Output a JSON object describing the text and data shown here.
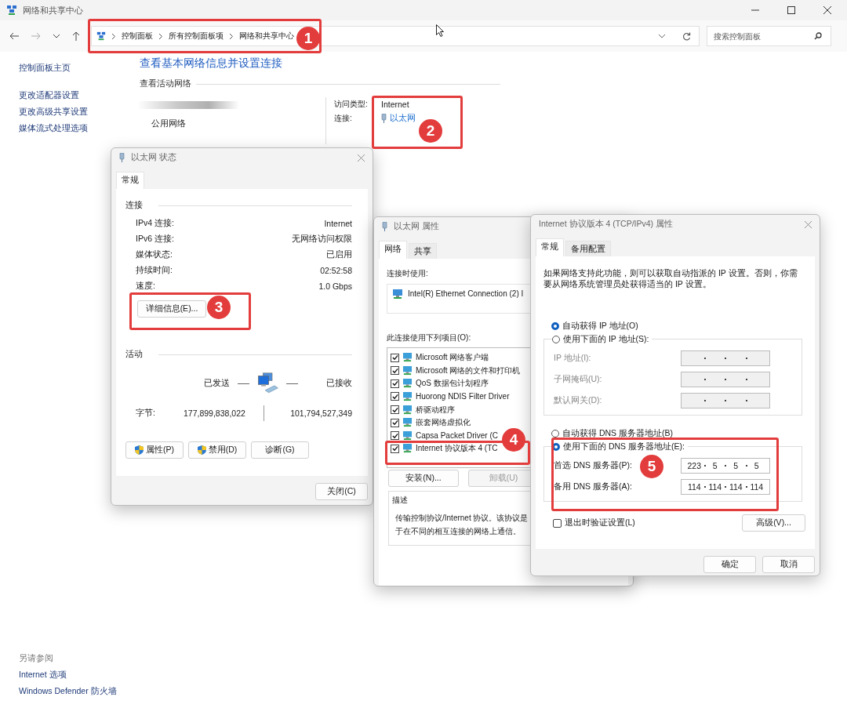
{
  "window": {
    "title": "网络和共享中心"
  },
  "address_bar": {
    "crumbs": [
      "控制面板",
      "所有控制面板项",
      "网络和共享中心"
    ]
  },
  "search": {
    "placeholder": "搜索控制面板"
  },
  "sidebar": {
    "links": [
      "控制面板主页",
      "更改适配器设置",
      "更改高级共享设置",
      "媒体流式处理选项"
    ],
    "see_also_title": "另请参阅",
    "see_also": [
      "Internet 选项",
      "Windows Defender 防火墙"
    ]
  },
  "main": {
    "heading": "查看基本网络信息并设置连接",
    "section": "查看活动网络",
    "network_type": "公用网络",
    "access_label": "访问类型:",
    "access_value": "Internet",
    "connection_label": "连接:",
    "connection_link": "以太网"
  },
  "status_dialog": {
    "title": "以太网 状态",
    "tabs": [
      {
        "label": "常规",
        "selected": true
      }
    ],
    "connection_group": "连接",
    "rows": [
      {
        "label": "IPv4 连接:",
        "value": "Internet"
      },
      {
        "label": "IPv6 连接:",
        "value": "无网络访问权限"
      },
      {
        "label": "媒体状态:",
        "value": "已启用"
      },
      {
        "label": "持续时间:",
        "value": "02:52:58"
      },
      {
        "label": "速度:",
        "value": "1.0 Gbps"
      }
    ],
    "details_button": "详细信息(E)...",
    "activity_group": "活动",
    "sent": "已发送",
    "received": "已接收",
    "bytes_label": "字节:",
    "bytes_sent": "177,899,838,022",
    "bytes_received": "101,794,527,349",
    "buttons": [
      {
        "label": "属性(P)",
        "shield": true
      },
      {
        "label": "禁用(D)",
        "shield": true
      },
      {
        "label": "诊断(G)",
        "shield": false
      }
    ],
    "close_button": "关闭(C)"
  },
  "properties_dialog": {
    "title": "以太网 属性",
    "tabs": [
      {
        "label": "网络",
        "selected": true
      },
      {
        "label": "共享",
        "selected": false
      }
    ],
    "connect_using_label": "连接时使用:",
    "adapter": "Intel(R) Ethernet Connection (2) I",
    "items_label": "此连接使用下列项目(O):",
    "items": [
      {
        "label": "Microsoft 网络客户端",
        "checked": true
      },
      {
        "label": "Microsoft 网络的文件和打印机",
        "checked": true
      },
      {
        "label": "QoS 数据包计划程序",
        "checked": true
      },
      {
        "label": "Huorong NDIS Filter Driver",
        "checked": true
      },
      {
        "label": "桥驱动程序",
        "checked": true
      },
      {
        "label": "嵌套网络虚拟化",
        "checked": true
      },
      {
        "label": "Capsa Packet Driver (C",
        "checked": true
      },
      {
        "label": "Internet 协议版本 4 (TC",
        "checked": true
      }
    ],
    "buttons": [
      {
        "label": "安装(N)...",
        "disabled": false
      },
      {
        "label": "卸载(U)",
        "disabled": true
      }
    ],
    "description_group": "描述",
    "description": [
      "传输控制协议/Internet 协议。该协议是",
      "于在不同的相互连接的网络上通信。"
    ]
  },
  "tcpip_dialog": {
    "title": "Internet 协议版本 4 (TCP/IPv4) 属性",
    "tabs": [
      {
        "label": "常规",
        "selected": true
      },
      {
        "label": "备用配置",
        "selected": false
      }
    ],
    "intro": "如果网络支持此功能，则可以获取自动指派的 IP 设置。否则，你需要从网络系统管理员处获得适当的 IP 设置。",
    "ip_options": [
      {
        "label": "自动获得 IP 地址(O)",
        "selected": true
      },
      {
        "label": "使用下面的 IP 地址(S):",
        "selected": false
      }
    ],
    "ip_fields": [
      {
        "label": "IP 地址(I):",
        "disabled": true
      },
      {
        "label": "子网掩码(U):",
        "disabled": true
      },
      {
        "label": "默认网关(D):",
        "disabled": true
      }
    ],
    "dns_options": [
      {
        "label": "自动获得 DNS 服务器地址(B)",
        "selected": false
      },
      {
        "label": "使用下面的 DNS 服务器地址(E):",
        "selected": true
      }
    ],
    "dns_fields": [
      {
        "label": "首选 DNS 服务器(P):",
        "octets": [
          "223",
          "5",
          "5",
          "5"
        ]
      },
      {
        "label": "备用 DNS 服务器(A):",
        "octets": [
          "114",
          "114",
          "114",
          "114"
        ]
      }
    ],
    "validate": {
      "label": "退出时验证设置(L)",
      "checked": false
    },
    "advanced_button": "高级(V)...",
    "ok_button": "确定",
    "cancel_button": "取消"
  },
  "annotations": [
    {
      "number": "1"
    },
    {
      "number": "2"
    },
    {
      "number": "3"
    },
    {
      "number": "4"
    },
    {
      "number": "5"
    }
  ]
}
